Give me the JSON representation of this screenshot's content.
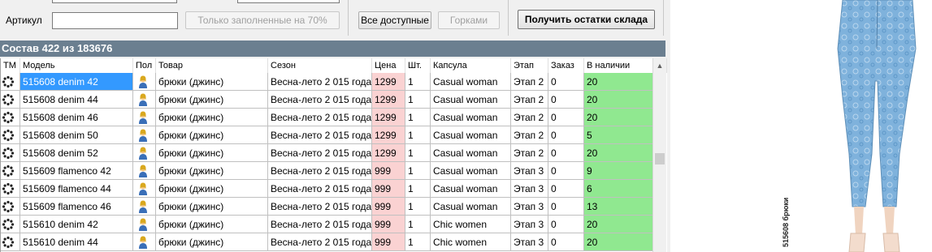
{
  "filter": {
    "article_label": "Артикул",
    "article_value": "",
    "filled_70_button": "Только заполненные на 70%",
    "all_available_button": "Все доступные",
    "slides_button": "Горками",
    "get_stock_button": "Получить остатки склада"
  },
  "composition_header": "Состав 422 из 183676",
  "columns": [
    "ТМ",
    "Модель",
    "Пол",
    "Товар",
    "Сезон",
    "Цена",
    "Шт.",
    "Капсула",
    "Этап",
    "Заказ",
    "В наличии"
  ],
  "rows": [
    {
      "model": "515608 denim  42",
      "product": "брюки (джинс)",
      "season": "Весна-лето 2 015 года",
      "price": "1299",
      "qty": "1",
      "capsule": "Casual woman",
      "stage": "Этап 2",
      "order": "0",
      "stock": "20"
    },
    {
      "model": "515608 denim  44",
      "product": "брюки (джинс)",
      "season": "Весна-лето 2 015 года",
      "price": "1299",
      "qty": "1",
      "capsule": "Casual woman",
      "stage": "Этап 2",
      "order": "0",
      "stock": "20"
    },
    {
      "model": "515608 denim  46",
      "product": "брюки (джинс)",
      "season": "Весна-лето 2 015 года",
      "price": "1299",
      "qty": "1",
      "capsule": "Casual woman",
      "stage": "Этап 2",
      "order": "0",
      "stock": "20"
    },
    {
      "model": "515608 denim  50",
      "product": "брюки (джинс)",
      "season": "Весна-лето 2 015 года",
      "price": "1299",
      "qty": "1",
      "capsule": "Casual woman",
      "stage": "Этап 2",
      "order": "0",
      "stock": "5"
    },
    {
      "model": "515608 denim  52",
      "product": "брюки (джинс)",
      "season": "Весна-лето 2 015 года",
      "price": "1299",
      "qty": "1",
      "capsule": "Casual woman",
      "stage": "Этап 2",
      "order": "0",
      "stock": "20"
    },
    {
      "model": "515609 flamenco  42",
      "product": "брюки (джинс)",
      "season": "Весна-лето 2 015 года",
      "price": "999",
      "qty": "1",
      "capsule": "Casual woman",
      "stage": "Этап 3",
      "order": "0",
      "stock": "9"
    },
    {
      "model": "515609 flamenco  44",
      "product": "брюки (джинс)",
      "season": "Весна-лето 2 015 года",
      "price": "999",
      "qty": "1",
      "capsule": "Casual woman",
      "stage": "Этап 3",
      "order": "0",
      "stock": "6"
    },
    {
      "model": "515609 flamenco  46",
      "product": "брюки (джинс)",
      "season": "Весна-лето 2 015 года",
      "price": "999",
      "qty": "1",
      "capsule": "Casual woman",
      "stage": "Этап 3",
      "order": "0",
      "stock": "13"
    },
    {
      "model": "515610 denim  42",
      "product": "брюки (джинс)",
      "season": "Весна-лето 2 015 года",
      "price": "999",
      "qty": "1",
      "capsule": "Chic women",
      "stage": "Этап 3",
      "order": "0",
      "stock": "20"
    },
    {
      "model": "515610 denim  44",
      "product": "брюки (джинс)",
      "season": "Весна-лето 2 015 года",
      "price": "999",
      "qty": "1",
      "capsule": "Chic women",
      "stage": "Этап 3",
      "order": "0",
      "stock": "20"
    }
  ],
  "icons": {
    "tm": "dotted-circle-icon",
    "gender": "woman-user-icon"
  },
  "colors": {
    "price_bg": "#fad2d2",
    "stock_bg": "#90e890",
    "selected": "#3399ff",
    "header_bar": "#6b7f90"
  },
  "product_image_caption": "515608 брюки"
}
